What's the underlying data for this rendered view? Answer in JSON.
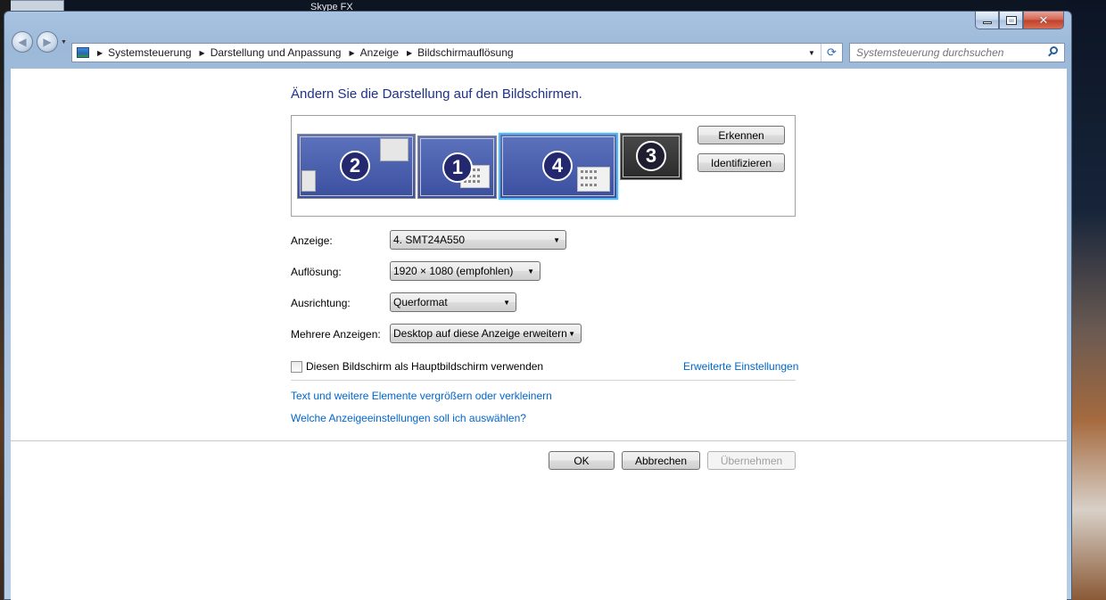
{
  "desktop": {
    "icon_label": "Skype FX"
  },
  "window": {
    "controls": {
      "minimize": "minimize",
      "maximize": "maximize",
      "close": "close"
    }
  },
  "nav": {
    "breadcrumbs": [
      "Systemsteuerung",
      "Darstellung und Anpassung",
      "Anzeige",
      "Bildschirmauflösung"
    ],
    "search_placeholder": "Systemsteuerung durchsuchen"
  },
  "main": {
    "heading": "Ändern Sie die Darstellung auf den Bildschirmen.",
    "monitors": [
      {
        "number": "2",
        "selected": false
      },
      {
        "number": "1",
        "selected": false
      },
      {
        "number": "4",
        "selected": true
      },
      {
        "number": "3",
        "selected": false
      }
    ],
    "buttons": {
      "detect": "Erkennen",
      "identify": "Identifizieren"
    },
    "fields": {
      "display_label": "Anzeige:",
      "display_value": "4. SMT24A550",
      "resolution_label": "Auflösung:",
      "resolution_value": "1920 × 1080 (empfohlen)",
      "orientation_label": "Ausrichtung:",
      "orientation_value": "Querformat",
      "multiple_label": "Mehrere Anzeigen:",
      "multiple_value": "Desktop auf diese Anzeige erweitern"
    },
    "primary_checkbox_label": "Diesen Bildschirm als Hauptbildschirm verwenden",
    "primary_checked": false,
    "advanced_link": "Erweiterte Einstellungen",
    "link_text_size": "Text und weitere Elemente vergrößern oder verkleinern",
    "link_which_settings": "Welche Anzeigeeinstellungen soll ich auswählen?"
  },
  "footer": {
    "ok": "OK",
    "cancel": "Abbrechen",
    "apply": "Übernehmen"
  },
  "colors": {
    "heading": "#1e3287",
    "link": "#0066cc",
    "monitor_blue": "#3b4f9f",
    "monitor_selected_border": "#57b7f0"
  }
}
